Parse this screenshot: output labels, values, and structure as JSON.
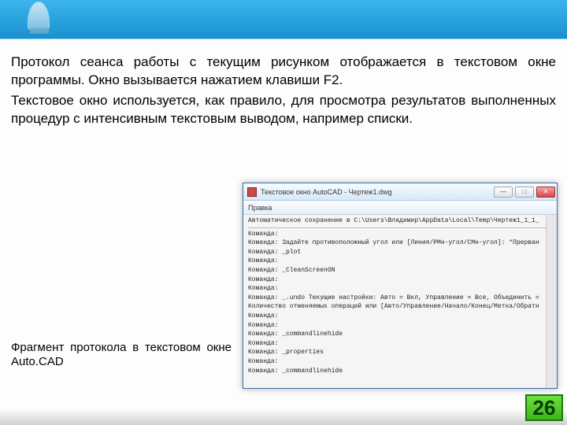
{
  "body": {
    "para1": "Протокол сеанса работы с текущим рисунком отображается в текстовом окне программы. Окно вызывается нажатием клавиши F2.",
    "para2": "Текстовое окно используется, как правило, для просмотра результатов выполненных процедур с интенсивным текстовым выводом, например списки."
  },
  "caption": "Фрагмент протокола в текстовом окне Auto.CAD",
  "window": {
    "title": "Текстовое окно AutoCAD - Чертеж1.dwg",
    "menu": "Правка",
    "min": "—",
    "max": "□",
    "close": "✕",
    "lines": [
      "Автоматическое сохранение в C:\\Users\\Владимир\\AppData\\Local\\Temp\\Чертеж1_1_1_",
      "",
      "Команда:",
      "Команда: Задайте противоположный угол или [Линия/РМн-угол/СМн-угол]: *Прерван",
      "",
      "Команда: _plot",
      "Команда:",
      "Команда: _CleanScreenON",
      "Команда:",
      "Команда:",
      "Команда: _.undo Текущие настройки: Авто = Вкл, Управление = Все, Объединить =",
      "Количество отменяемых операций или [Авто/Управление/Начало/Конец/Метка/Обратн",
      "Команда:",
      "Команда:",
      "Команда: _commandlinehide",
      "Команда:",
      "Команда: _properties",
      "Команда:",
      "Команда: _commandlinehide"
    ]
  },
  "page": "26"
}
